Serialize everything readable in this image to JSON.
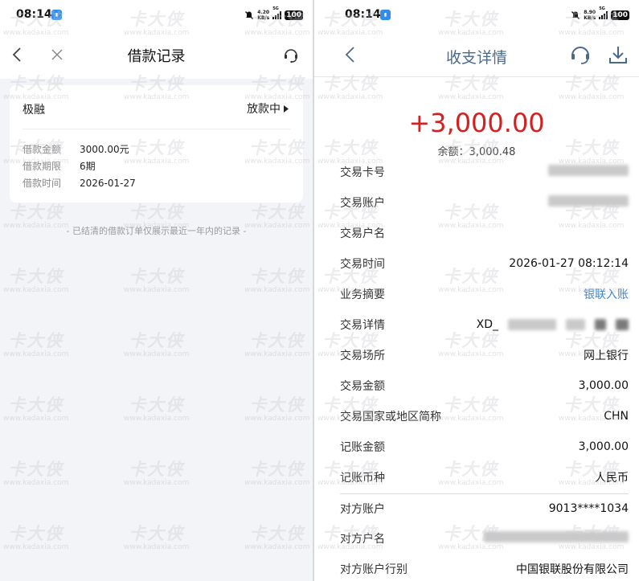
{
  "left": {
    "status": {
      "time": "08:14",
      "net_speed": "4.20",
      "net_unit": "KB/s",
      "signal": "5G",
      "battery": "100"
    },
    "nav": {
      "title": "借款记录"
    },
    "card": {
      "product": "极融",
      "status": "放款中",
      "rows": [
        {
          "label": "借款金额",
          "value": "3000.00元"
        },
        {
          "label": "借款期限",
          "value": "6期"
        },
        {
          "label": "借款时间",
          "value": "2026-01-27"
        }
      ]
    },
    "footnote": "- 已结清的借款订单仅展示最近一年内的记录 -"
  },
  "right": {
    "status": {
      "time": "08:14",
      "net_speed": "8.90",
      "net_unit": "KB/s",
      "signal": "5G",
      "battery": "100"
    },
    "nav": {
      "title": "收支详情"
    },
    "amount": "+3,000.00",
    "balance": "余额：3,000.48",
    "rows": [
      {
        "label": "交易卡号",
        "value": ""
      },
      {
        "label": "交易账户",
        "value": ""
      },
      {
        "label": "交易户名",
        "value": ""
      },
      {
        "label": "交易时间",
        "value": "2026-01-27 08:12:14"
      },
      {
        "label": "业务摘要",
        "value": "银联入账"
      },
      {
        "label": "交易详情",
        "value": "XD_"
      },
      {
        "label": "交易场所",
        "value": "网上银行"
      },
      {
        "label": "交易金额",
        "value": "3,000.00"
      },
      {
        "label": "交易国家或地区简称",
        "value": "CHN"
      },
      {
        "label": "记账金额",
        "value": "3,000.00"
      },
      {
        "label": "记账币种",
        "value": "人民币"
      },
      {
        "label": "对方账户",
        "value": "9013****1034"
      },
      {
        "label": "对方户名",
        "value": ""
      },
      {
        "label": "对方账户行别",
        "value": "中国银联股份有限公司"
      }
    ]
  },
  "watermark": {
    "mark": "卡大侠",
    "site": "www.kadaxia.com"
  },
  "colors": {
    "amount_red": "#d52020",
    "link_blue": "#3a86d8",
    "title_blue": "#4a6a8c",
    "left_bg": "#f3f4f8"
  }
}
